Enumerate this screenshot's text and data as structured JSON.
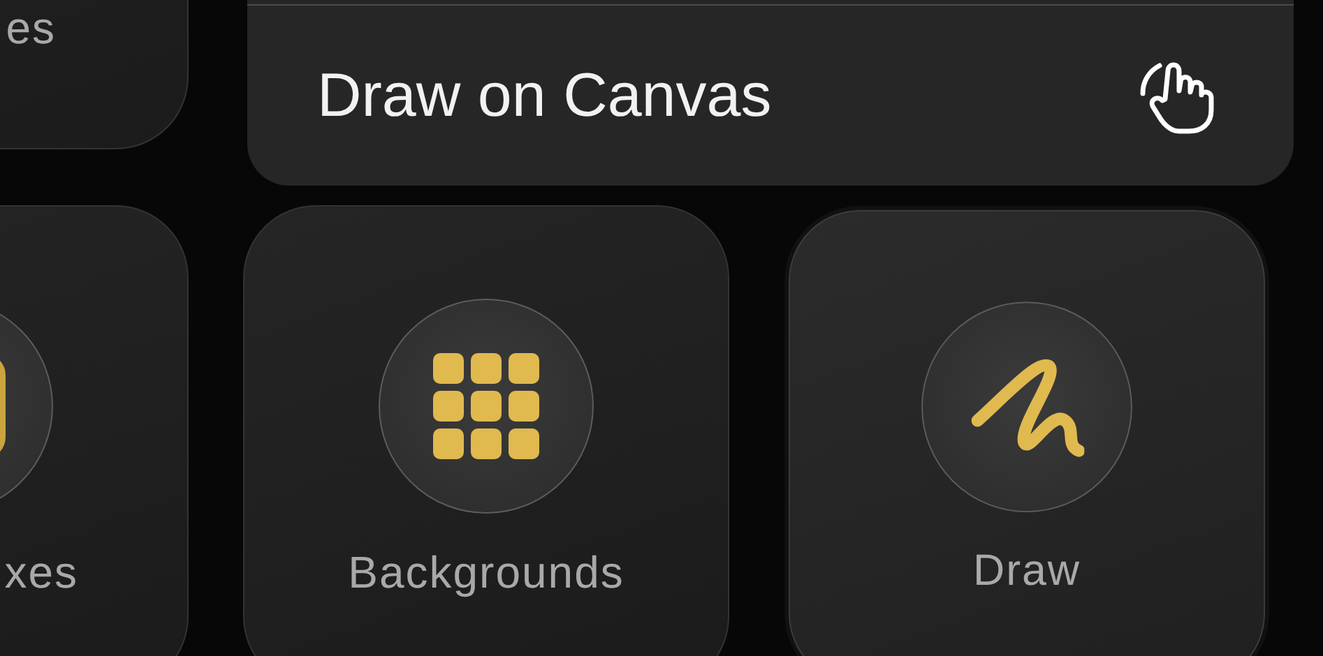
{
  "top_tiles": [
    {
      "label": "es",
      "cut": true
    }
  ],
  "menu": {
    "items": [
      {
        "label": "Draw on Canvas",
        "kind": "tap"
      }
    ]
  },
  "tiles": [
    {
      "label": "xes",
      "kind": "box",
      "cut": true,
      "selected": false
    },
    {
      "label": "Backgrounds",
      "kind": "grid",
      "cut": false,
      "selected": false
    },
    {
      "label": "Draw",
      "kind": "scribble",
      "cut": false,
      "selected": true
    }
  ]
}
